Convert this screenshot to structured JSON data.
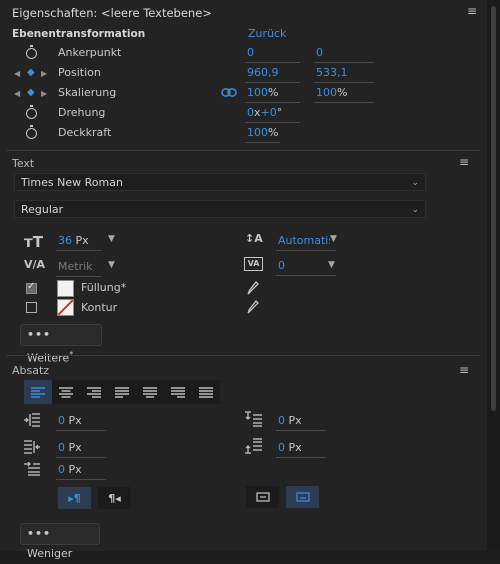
{
  "panel": {
    "title": "Eigenschaften: <leere Textebene>"
  },
  "transform": {
    "header": "Ebenentransformation",
    "reset": "Zurück",
    "rows": [
      {
        "label": "Ankerpunkt",
        "v1": "0",
        "v2": "0"
      },
      {
        "label": "Position",
        "v1": "960,9",
        "v2": "533,1"
      },
      {
        "label": "Skalierung",
        "v1": "100",
        "v1_unit": "%",
        "v2": "100",
        "v2_unit": "%"
      },
      {
        "label": "Drehung",
        "v1": "0",
        "v1_mid": "x",
        "v1_deg": "+0",
        "v1_unit": "°"
      },
      {
        "label": "Deckkraft",
        "v1": "100",
        "v1_unit": "%"
      }
    ]
  },
  "text": {
    "header": "Text",
    "font_family": "Times New Roman",
    "font_style": "Regular",
    "font_size": "36",
    "font_size_unit": "Px",
    "kerning": "Metrik",
    "leading": "Automatisch",
    "tracking": "0",
    "fill_label": "Füllung",
    "fill_suffix": "*",
    "fill_checked": true,
    "stroke_label": "Kontur",
    "stroke_checked": false,
    "more_button": "Weitere",
    "more_suffix": "*"
  },
  "paragraph": {
    "header": "Absatz",
    "indent_left": "0",
    "indent_left_unit": "Px",
    "space_before": "0",
    "space_before_unit": "Px",
    "indent_right": "0",
    "indent_right_unit": "Px",
    "space_after": "0",
    "space_after_unit": "Px",
    "first_line": "0",
    "first_line_unit": "Px",
    "less_button": "Weniger"
  },
  "colors": {
    "accent": "#3d8fe0",
    "panel_bg": "#232323",
    "fill_swatch": "#f2f2f2",
    "stroke_swatch_line": "#e02b2b"
  }
}
